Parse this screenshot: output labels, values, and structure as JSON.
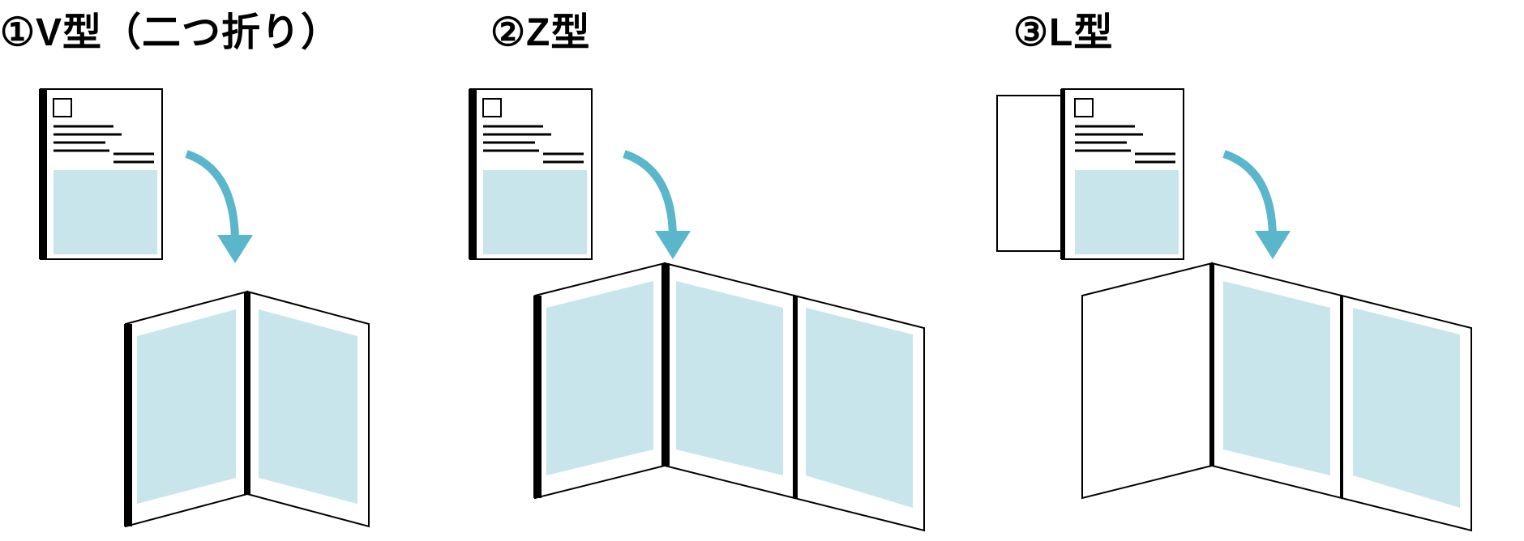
{
  "headings": {
    "h1": "①V型（二つ折り）",
    "h2": "②Z型",
    "h3": "③L型"
  },
  "colors": {
    "fill": "#c7e5ea",
    "arrow": "#59b6cb",
    "stroke": "#000000"
  },
  "diagram": {
    "types": [
      {
        "id": "V",
        "label_jp": "V型（二つ折り）",
        "open_panels": 2,
        "closed_has_back_panel": false
      },
      {
        "id": "Z",
        "label_jp": "Z型",
        "open_panels": 3,
        "closed_has_back_panel": false
      },
      {
        "id": "L",
        "label_jp": "L型",
        "open_panels": 3,
        "closed_has_back_panel": true
      }
    ]
  }
}
